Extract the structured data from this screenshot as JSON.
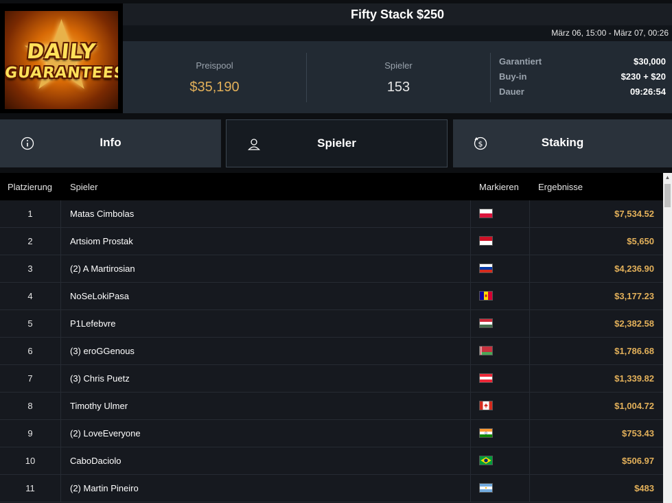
{
  "logo": {
    "line1": "DAILY",
    "line2": "GUARANTEES"
  },
  "header": {
    "title": "Fifty Stack $250",
    "dates": "März 06, 15:00 - März 07, 00:26"
  },
  "stats": {
    "prize_label": "Preispool",
    "prize_value": "$35,190",
    "players_label": "Spieler",
    "players_value": "153",
    "details": [
      {
        "key": "Garantiert",
        "value": "$30,000"
      },
      {
        "key": "Buy-in",
        "value": "$230 + $20"
      },
      {
        "key": "Dauer",
        "value": "09:26:54"
      }
    ]
  },
  "tabs": [
    {
      "label": "Info",
      "icon": "info-icon",
      "active": false
    },
    {
      "label": "Spieler",
      "icon": "user-icon",
      "active": true
    },
    {
      "label": "Staking",
      "icon": "staking-coin-icon",
      "active": false
    }
  ],
  "table": {
    "headers": {
      "rank": "Platzierung",
      "player": "Spieler",
      "flag": "Markieren",
      "result": "Ergebnisse"
    },
    "rows": [
      {
        "rank": "1",
        "name": "Matas Cimbolas",
        "flag": "poland",
        "prize": "$7,534.52"
      },
      {
        "rank": "2",
        "name": "Artsiom Prostak",
        "flag": "indonesia",
        "prize": "$5,650"
      },
      {
        "rank": "3",
        "name": "(2) A Martirosian",
        "flag": "russia",
        "prize": "$4,236.90"
      },
      {
        "rank": "4",
        "name": "NoSeLokiPasa",
        "flag": "andorra",
        "prize": "$3,177.23"
      },
      {
        "rank": "5",
        "name": "P1Lefebvre",
        "flag": "hungary",
        "prize": "$2,382.58"
      },
      {
        "rank": "6",
        "name": "(3) eroGGenous",
        "flag": "belarus",
        "prize": "$1,786.68"
      },
      {
        "rank": "7",
        "name": "(3) Chris Puetz",
        "flag": "austria",
        "prize": "$1,339.82"
      },
      {
        "rank": "8",
        "name": "Timothy Ulmer",
        "flag": "canada",
        "prize": "$1,004.72"
      },
      {
        "rank": "9",
        "name": "(2) LoveEveryone",
        "flag": "india",
        "prize": "$753.43"
      },
      {
        "rank": "10",
        "name": "CaboDaciolo",
        "flag": "brazil",
        "prize": "$506.97"
      },
      {
        "rank": "11",
        "name": "(2) Martin Pineiro",
        "flag": "argentina",
        "prize": "$483"
      }
    ]
  },
  "colors": {
    "accent_gold": "#e2b05a",
    "panel": "#222a33",
    "tab": "#2a323b",
    "table_bg": "#16191f"
  }
}
